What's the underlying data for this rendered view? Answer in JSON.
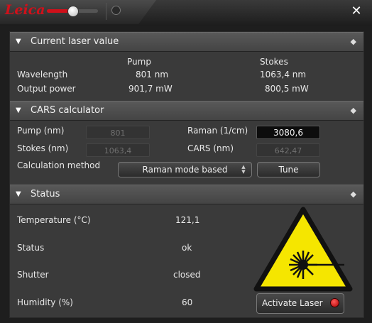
{
  "brand": {
    "logo_text": "Leica",
    "accent_color": "#d0101a"
  },
  "titlebar": {
    "slider_value_percent": 50,
    "close_label": "✕"
  },
  "current_laser": {
    "title": "Current laser value",
    "col_pump": "Pump",
    "col_stokes": "Stokes",
    "rows": [
      {
        "label": "Wavelength",
        "pump": "801 nm",
        "stokes": "1063,4 nm"
      },
      {
        "label": "Output power",
        "pump": "901,7 mW",
        "stokes": "800,5 mW"
      }
    ]
  },
  "cars": {
    "title": "CARS calculator",
    "pump_label": "Pump (nm)",
    "pump_value": "801",
    "raman_label": "Raman (1/cm)",
    "raman_value": "3080,6",
    "stokes_label": "Stokes (nm)",
    "stokes_value": "1063,4",
    "cars_label": "CARS (nm)",
    "cars_value": "642,47",
    "method_label": "Calculation method",
    "method_value": "Raman mode based",
    "tune_label": "Tune"
  },
  "status": {
    "title": "Status",
    "rows": [
      {
        "label": "Temperature (°C)",
        "value": "121,1"
      },
      {
        "label": "Status",
        "value": "ok"
      },
      {
        "label": "Shutter",
        "value": "closed"
      },
      {
        "label": "Humidity (%)",
        "value": "60"
      }
    ],
    "activate_label": "Activate Laser",
    "warning_color": "#f5e600"
  }
}
